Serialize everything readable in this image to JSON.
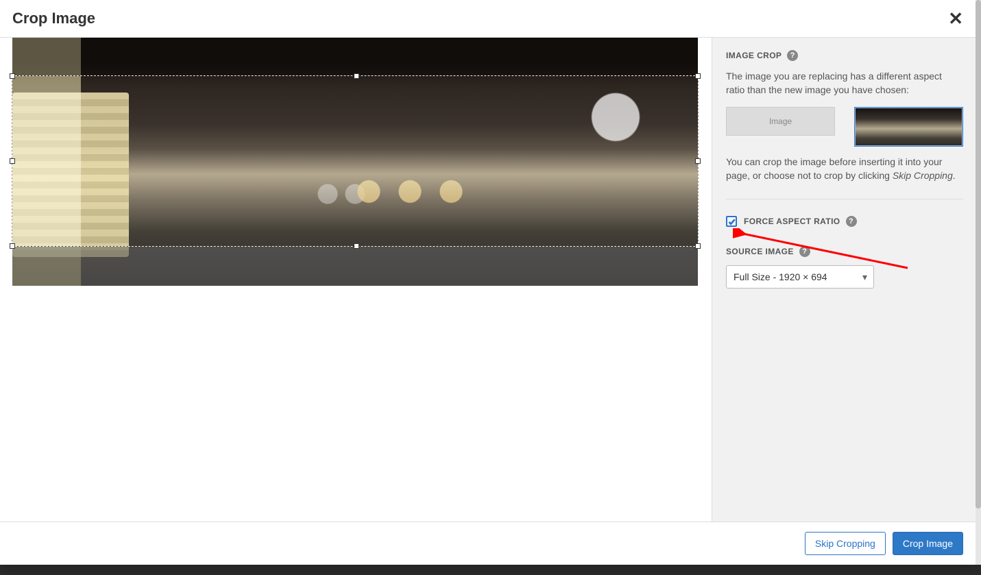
{
  "header": {
    "title": "Crop Image"
  },
  "sidebar": {
    "image_crop_label": "IMAGE CROP",
    "desc1": "The image you are replacing has a different aspect ratio than the new image you have chosen:",
    "placeholder_label": "Image",
    "desc2_a": "You can crop the image before inserting it into your page, or choose not to crop by clicking ",
    "desc2_italic": "Skip Cropping",
    "desc2_b": ".",
    "force_aspect_label": "FORCE ASPECT RATIO",
    "force_aspect_checked": true,
    "source_image_label": "SOURCE IMAGE",
    "source_select_value": "Full Size - 1920 × 694"
  },
  "footer": {
    "skip_label": "Skip Cropping",
    "crop_label": "Crop Image"
  },
  "icons": {
    "close": "✕",
    "help": "?",
    "chevron_down": "▾"
  }
}
